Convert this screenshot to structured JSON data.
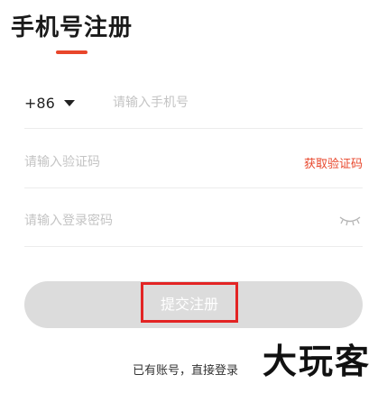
{
  "header": {
    "title": "手机号注册"
  },
  "colors": {
    "accent": "#e8462b",
    "highlight_border": "#e32424",
    "button_bg": "#dcdcdc",
    "placeholder": "#c4c4c4"
  },
  "phone": {
    "country_code": "+86",
    "placeholder": "请输入手机号"
  },
  "verify": {
    "placeholder": "请输入验证码",
    "get_code_label": "获取验证码"
  },
  "password": {
    "placeholder": "请输入登录密码",
    "toggle_icon": "eye-closed-icon"
  },
  "submit": {
    "label": "提交注册"
  },
  "footer": {
    "login_link": "已有账号，直接登录"
  },
  "watermark": {
    "text": "大玩客"
  }
}
